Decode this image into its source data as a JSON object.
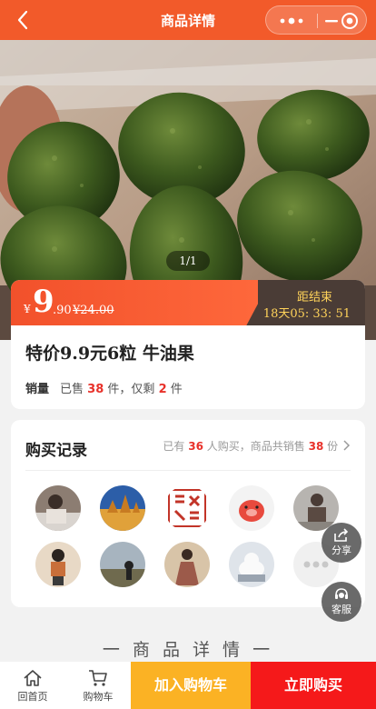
{
  "header": {
    "title": "商品详情"
  },
  "hero": {
    "pager": "1/1"
  },
  "price": {
    "currency": "¥",
    "integer": "9",
    "decimal": ".90",
    "original": "¥24.00",
    "countdown_label": "距结束",
    "countdown_time": "18天05: 33: 51"
  },
  "product": {
    "name": "特价9.9元6粒 牛油果",
    "sales_label": "销量",
    "sold_prefix": "已售",
    "sold_count": "38",
    "sold_mid": "件，仅剩",
    "remaining": "2",
    "remaining_suffix": "件"
  },
  "records": {
    "title": "购买记录",
    "info_prefix": "已有",
    "buyers": "36",
    "info_mid": "人购买，商品共销售",
    "total": "38",
    "info_suffix": "份"
  },
  "floating": {
    "share": "分享",
    "service": "客服"
  },
  "detail": {
    "title": "一 商 品 详 情 一"
  },
  "bottom": {
    "home": "回首页",
    "cart": "购物车",
    "add_to_cart": "加入购物车",
    "buy_now": "立即购买"
  },
  "colors": {
    "brand": "#f25a2a",
    "cart_button": "#fbb224",
    "buy_button": "#f5191a",
    "highlight": "#e8312a"
  }
}
